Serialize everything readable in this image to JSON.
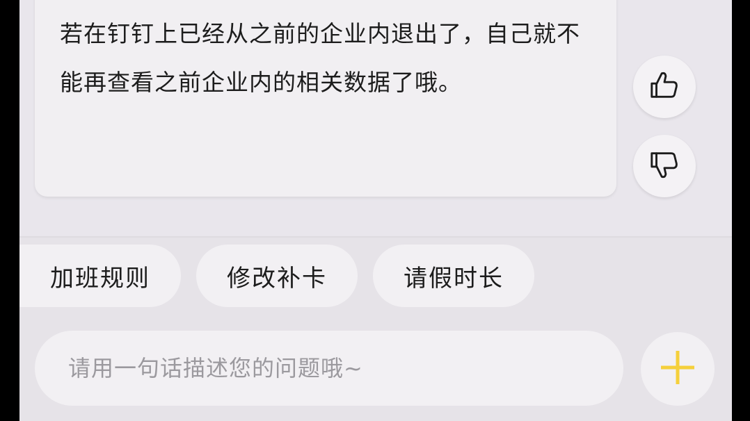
{
  "message": {
    "text": "若在钉钉上已经从之前的企业内退出了，自己就不能再查看之前企业内的相关数据了哦。"
  },
  "feedback": {
    "like_icon": "thumbs-up-icon",
    "dislike_icon": "thumbs-down-icon"
  },
  "quick_replies": [
    {
      "label": "加班规则"
    },
    {
      "label": "修改补卡"
    },
    {
      "label": "请假时长"
    }
  ],
  "input": {
    "placeholder": "请用一句话描述您的问题哦~",
    "value": ""
  },
  "actions": {
    "plus_icon": "plus-icon"
  },
  "colors": {
    "accent": "#f5d03b",
    "background": "#e6e3e8",
    "bubble": "#f1eff2",
    "text": "#1c1c1c",
    "placeholder": "#9b999e"
  }
}
